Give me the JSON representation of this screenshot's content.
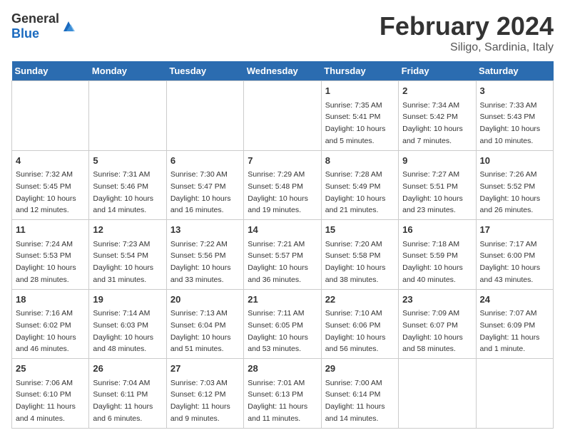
{
  "header": {
    "logo_general": "General",
    "logo_blue": "Blue",
    "title": "February 2024",
    "subtitle": "Siligo, Sardinia, Italy"
  },
  "weekdays": [
    "Sunday",
    "Monday",
    "Tuesday",
    "Wednesday",
    "Thursday",
    "Friday",
    "Saturday"
  ],
  "weeks": [
    [
      {
        "day": "",
        "info": ""
      },
      {
        "day": "",
        "info": ""
      },
      {
        "day": "",
        "info": ""
      },
      {
        "day": "",
        "info": ""
      },
      {
        "day": "1",
        "info": "Sunrise: 7:35 AM\nSunset: 5:41 PM\nDaylight: 10 hours\nand 5 minutes."
      },
      {
        "day": "2",
        "info": "Sunrise: 7:34 AM\nSunset: 5:42 PM\nDaylight: 10 hours\nand 7 minutes."
      },
      {
        "day": "3",
        "info": "Sunrise: 7:33 AM\nSunset: 5:43 PM\nDaylight: 10 hours\nand 10 minutes."
      }
    ],
    [
      {
        "day": "4",
        "info": "Sunrise: 7:32 AM\nSunset: 5:45 PM\nDaylight: 10 hours\nand 12 minutes."
      },
      {
        "day": "5",
        "info": "Sunrise: 7:31 AM\nSunset: 5:46 PM\nDaylight: 10 hours\nand 14 minutes."
      },
      {
        "day": "6",
        "info": "Sunrise: 7:30 AM\nSunset: 5:47 PM\nDaylight: 10 hours\nand 16 minutes."
      },
      {
        "day": "7",
        "info": "Sunrise: 7:29 AM\nSunset: 5:48 PM\nDaylight: 10 hours\nand 19 minutes."
      },
      {
        "day": "8",
        "info": "Sunrise: 7:28 AM\nSunset: 5:49 PM\nDaylight: 10 hours\nand 21 minutes."
      },
      {
        "day": "9",
        "info": "Sunrise: 7:27 AM\nSunset: 5:51 PM\nDaylight: 10 hours\nand 23 minutes."
      },
      {
        "day": "10",
        "info": "Sunrise: 7:26 AM\nSunset: 5:52 PM\nDaylight: 10 hours\nand 26 minutes."
      }
    ],
    [
      {
        "day": "11",
        "info": "Sunrise: 7:24 AM\nSunset: 5:53 PM\nDaylight: 10 hours\nand 28 minutes."
      },
      {
        "day": "12",
        "info": "Sunrise: 7:23 AM\nSunset: 5:54 PM\nDaylight: 10 hours\nand 31 minutes."
      },
      {
        "day": "13",
        "info": "Sunrise: 7:22 AM\nSunset: 5:56 PM\nDaylight: 10 hours\nand 33 minutes."
      },
      {
        "day": "14",
        "info": "Sunrise: 7:21 AM\nSunset: 5:57 PM\nDaylight: 10 hours\nand 36 minutes."
      },
      {
        "day": "15",
        "info": "Sunrise: 7:20 AM\nSunset: 5:58 PM\nDaylight: 10 hours\nand 38 minutes."
      },
      {
        "day": "16",
        "info": "Sunrise: 7:18 AM\nSunset: 5:59 PM\nDaylight: 10 hours\nand 40 minutes."
      },
      {
        "day": "17",
        "info": "Sunrise: 7:17 AM\nSunset: 6:00 PM\nDaylight: 10 hours\nand 43 minutes."
      }
    ],
    [
      {
        "day": "18",
        "info": "Sunrise: 7:16 AM\nSunset: 6:02 PM\nDaylight: 10 hours\nand 46 minutes."
      },
      {
        "day": "19",
        "info": "Sunrise: 7:14 AM\nSunset: 6:03 PM\nDaylight: 10 hours\nand 48 minutes."
      },
      {
        "day": "20",
        "info": "Sunrise: 7:13 AM\nSunset: 6:04 PM\nDaylight: 10 hours\nand 51 minutes."
      },
      {
        "day": "21",
        "info": "Sunrise: 7:11 AM\nSunset: 6:05 PM\nDaylight: 10 hours\nand 53 minutes."
      },
      {
        "day": "22",
        "info": "Sunrise: 7:10 AM\nSunset: 6:06 PM\nDaylight: 10 hours\nand 56 minutes."
      },
      {
        "day": "23",
        "info": "Sunrise: 7:09 AM\nSunset: 6:07 PM\nDaylight: 10 hours\nand 58 minutes."
      },
      {
        "day": "24",
        "info": "Sunrise: 7:07 AM\nSunset: 6:09 PM\nDaylight: 11 hours\nand 1 minute."
      }
    ],
    [
      {
        "day": "25",
        "info": "Sunrise: 7:06 AM\nSunset: 6:10 PM\nDaylight: 11 hours\nand 4 minutes."
      },
      {
        "day": "26",
        "info": "Sunrise: 7:04 AM\nSunset: 6:11 PM\nDaylight: 11 hours\nand 6 minutes."
      },
      {
        "day": "27",
        "info": "Sunrise: 7:03 AM\nSunset: 6:12 PM\nDaylight: 11 hours\nand 9 minutes."
      },
      {
        "day": "28",
        "info": "Sunrise: 7:01 AM\nSunset: 6:13 PM\nDaylight: 11 hours\nand 11 minutes."
      },
      {
        "day": "29",
        "info": "Sunrise: 7:00 AM\nSunset: 6:14 PM\nDaylight: 11 hours\nand 14 minutes."
      },
      {
        "day": "",
        "info": ""
      },
      {
        "day": "",
        "info": ""
      }
    ]
  ]
}
